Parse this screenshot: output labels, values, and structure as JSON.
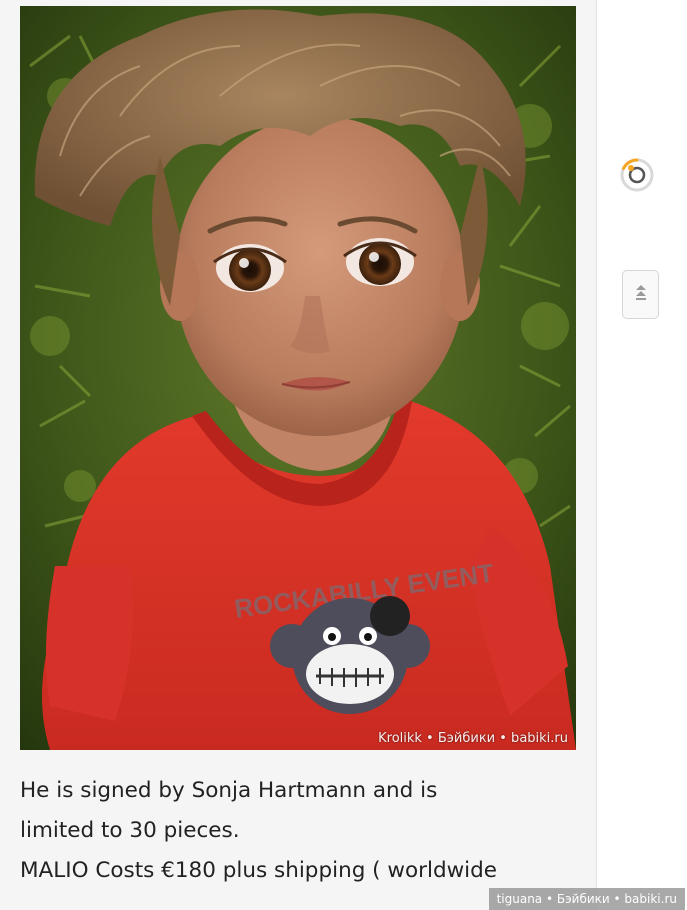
{
  "post": {
    "photo": {
      "alt": "doll",
      "watermark": "Krolikk • Бэйбики • babiki.ru",
      "shirt_print_text": "ROCKABILLY EVENT"
    },
    "caption_lines": [
      "He is signed by Sonja Hartmann and is",
      "limited to 30 pieces.",
      "MALIO Costs €180 plus shipping ( worldwide"
    ]
  },
  "sidebar": {
    "loading_icon": "spinner-icon",
    "scroll_top_icon": "double-chevron-up-icon"
  },
  "footer": {
    "watermark": "tiguana • Бэйбики • babiki.ru"
  },
  "colors": {
    "accent_orange": "#f5a623",
    "background": "#f5f5f5",
    "text": "#222222"
  }
}
